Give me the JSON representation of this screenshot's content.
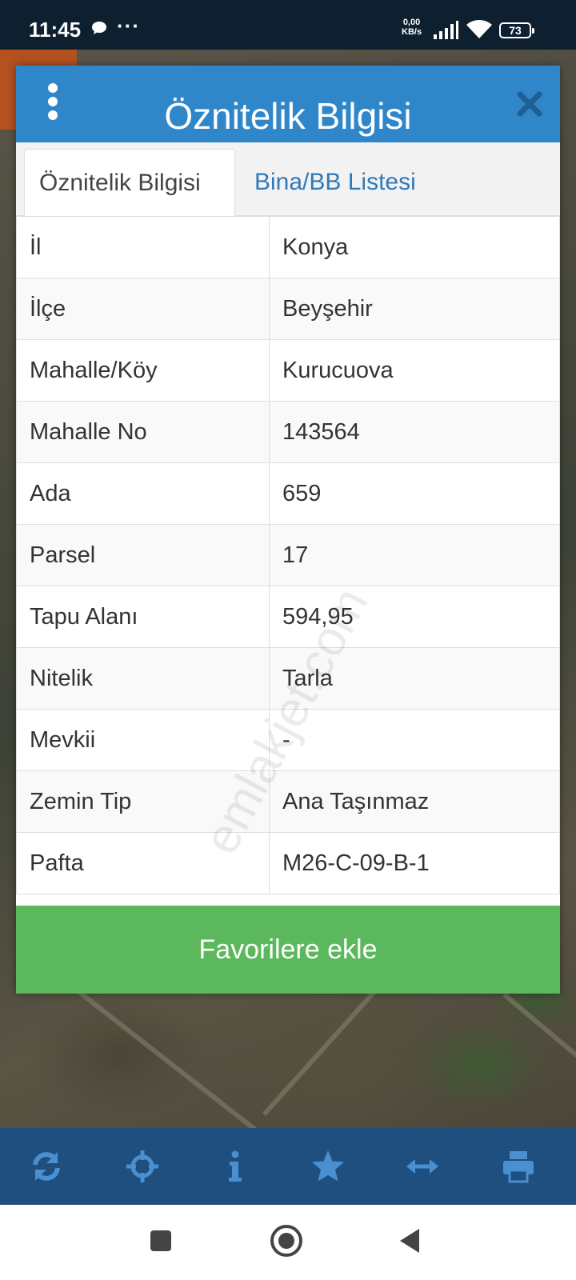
{
  "status_bar": {
    "time": "11:45",
    "more": "···",
    "net_speed_value": "0,00",
    "net_speed_unit": "KB/s",
    "battery": "73"
  },
  "dialog": {
    "title": "Öznitelik Bilgisi",
    "tabs": [
      {
        "label": "Öznitelik Bilgisi",
        "active": true
      },
      {
        "label": "Bina/BB Listesi",
        "active": false
      }
    ],
    "rows": [
      {
        "key": "İl",
        "value": "Konya"
      },
      {
        "key": "İlçe",
        "value": "Beyşehir"
      },
      {
        "key": "Mahalle/Köy",
        "value": "Kurucuova"
      },
      {
        "key": "Mahalle No",
        "value": "143564"
      },
      {
        "key": "Ada",
        "value": "659"
      },
      {
        "key": "Parsel",
        "value": "17"
      },
      {
        "key": "Tapu Alanı",
        "value": "594,95"
      },
      {
        "key": "Nitelik",
        "value": "Tarla"
      },
      {
        "key": "Mevkii",
        "value": "-"
      },
      {
        "key": "Zemin Tip",
        "value": "Ana Taşınmaz"
      },
      {
        "key": "Pafta",
        "value": "M26-C-09-B-1"
      }
    ],
    "favorite_button": "Favorilere ekle"
  },
  "watermark": "emlakjet.com",
  "toolbar": {
    "icons": [
      "refresh-icon",
      "locate-icon",
      "info-icon",
      "star-icon",
      "measure-icon",
      "print-icon"
    ]
  },
  "colors": {
    "header": "#2f86c9",
    "button": "#5cb85c",
    "toolbar": "#1f4f7e",
    "status_bar": "#0e1f2f"
  }
}
